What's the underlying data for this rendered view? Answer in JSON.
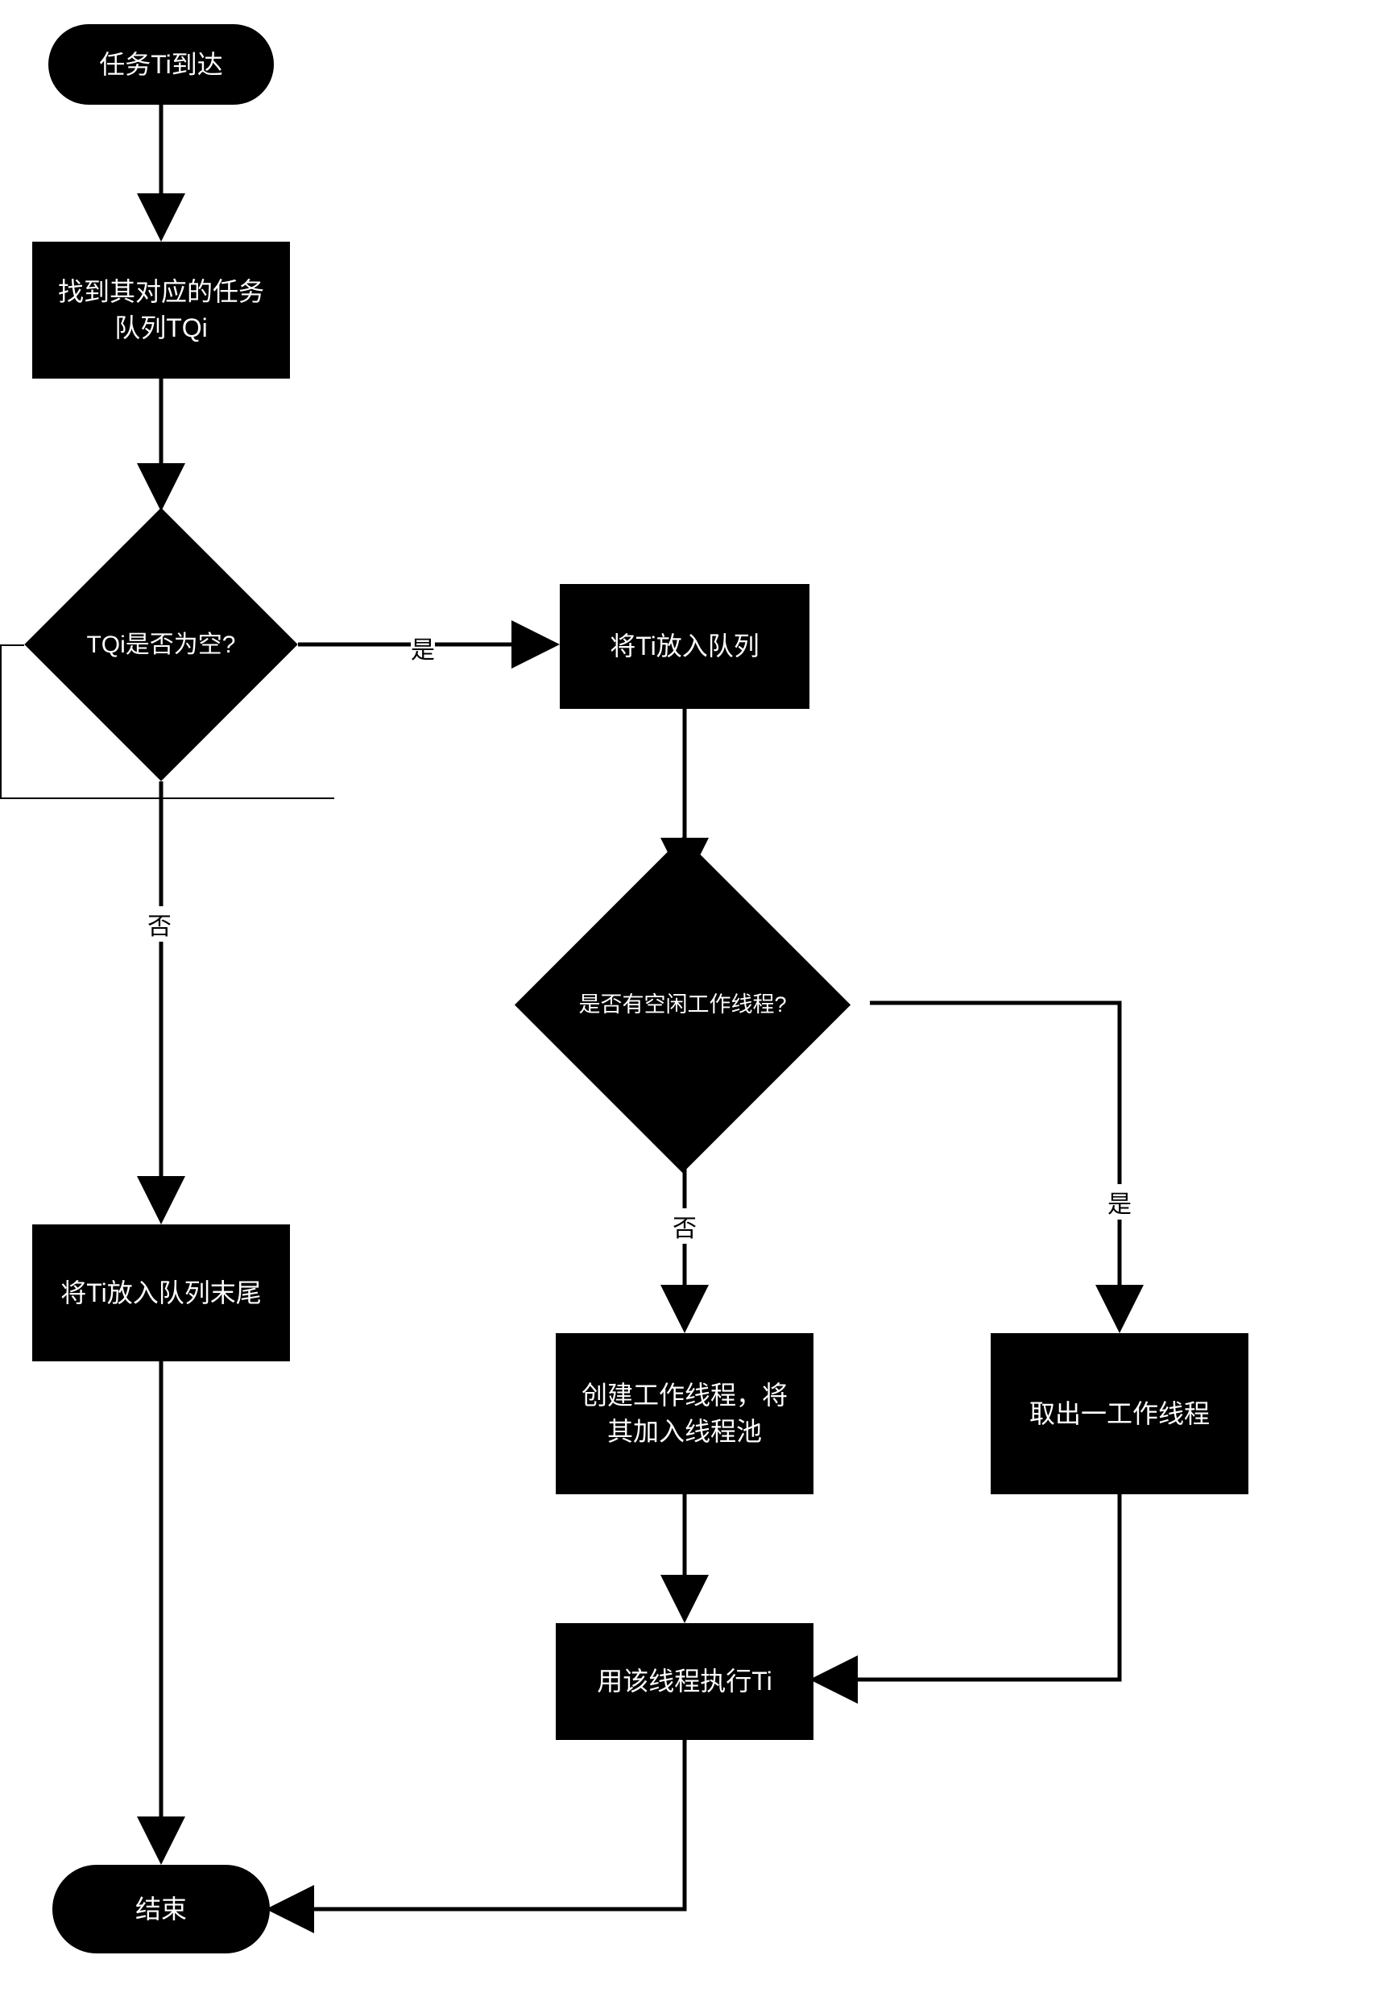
{
  "chart_data": {
    "type": "flowchart",
    "nodes": [
      {
        "id": "start",
        "type": "terminator",
        "label": "任务Ti到达"
      },
      {
        "id": "findQueue",
        "type": "process",
        "label": "找到其对应的任务\n队列TQi"
      },
      {
        "id": "queueEmpty",
        "type": "decision",
        "label": "TQi是否为空?"
      },
      {
        "id": "enqueue",
        "type": "process",
        "label": "将Ti放入队列"
      },
      {
        "id": "idleThread",
        "type": "decision",
        "label": "是否有空闲工作线程?"
      },
      {
        "id": "appendTail",
        "type": "process",
        "label": "将Ti放入队列末尾"
      },
      {
        "id": "createTh",
        "type": "process",
        "label": "创建工作线程，将\n其加入线程池"
      },
      {
        "id": "takeTh",
        "type": "process",
        "label": "取出一工作线程"
      },
      {
        "id": "runTi",
        "type": "process",
        "label": "用该线程执行Ti"
      },
      {
        "id": "end",
        "type": "terminator",
        "label": "结束"
      }
    ],
    "edges": [
      {
        "from": "start",
        "to": "findQueue"
      },
      {
        "from": "findQueue",
        "to": "queueEmpty"
      },
      {
        "from": "queueEmpty",
        "to": "enqueue",
        "label": "是"
      },
      {
        "from": "queueEmpty",
        "to": "appendTail",
        "label": "否"
      },
      {
        "from": "enqueue",
        "to": "idleThread"
      },
      {
        "from": "idleThread",
        "to": "createTh",
        "label": "否"
      },
      {
        "from": "idleThread",
        "to": "takeTh",
        "label": "是"
      },
      {
        "from": "createTh",
        "to": "runTi"
      },
      {
        "from": "takeTh",
        "to": "runTi"
      },
      {
        "from": "runTi",
        "to": "end"
      },
      {
        "from": "appendTail",
        "to": "end"
      }
    ],
    "edge_labels": {
      "yes": "是",
      "no": "否"
    }
  }
}
